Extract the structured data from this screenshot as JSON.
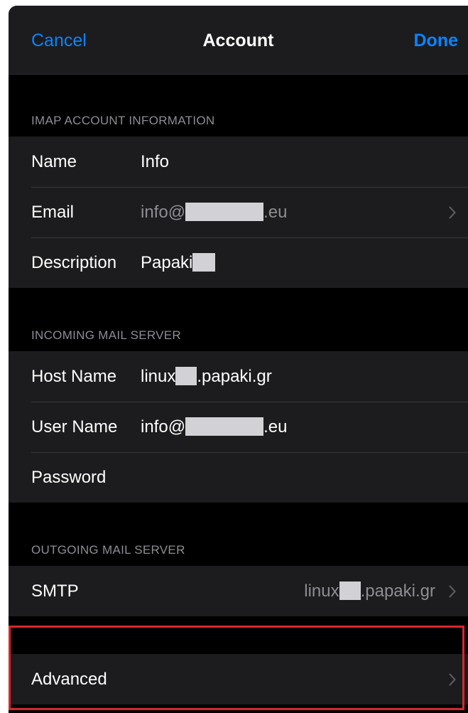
{
  "nav": {
    "cancel_label": "Cancel",
    "title": "Account",
    "done_label": "Done"
  },
  "imap_section": {
    "header": "IMAP ACCOUNT INFORMATION",
    "name": {
      "label": "Name",
      "value": "Info"
    },
    "email": {
      "label": "Email",
      "value_prefix": "info@",
      "value_suffix": ".eu"
    },
    "description": {
      "label": "Description",
      "value": "Papaki"
    }
  },
  "incoming_section": {
    "header": "INCOMING MAIL SERVER",
    "host_name": {
      "label": "Host Name",
      "value_prefix": "linux",
      "value_suffix": ".papaki.gr"
    },
    "user_name": {
      "label": "User Name",
      "value_prefix": "info@",
      "value_suffix": ".eu"
    },
    "password": {
      "label": "Password"
    }
  },
  "outgoing_section": {
    "header": "OUTGOING MAIL SERVER",
    "smtp": {
      "label": "SMTP",
      "value_prefix": "linux",
      "value_suffix": ".papaki.gr"
    }
  },
  "advanced": {
    "label": "Advanced"
  },
  "icons": {
    "chevron": "chevron-right-icon"
  },
  "colors": {
    "accent": "#0a84ff",
    "background": "#000000",
    "cell": "#1c1c1e",
    "secondary_text": "#8d8d93",
    "highlight": "#d9262e"
  }
}
